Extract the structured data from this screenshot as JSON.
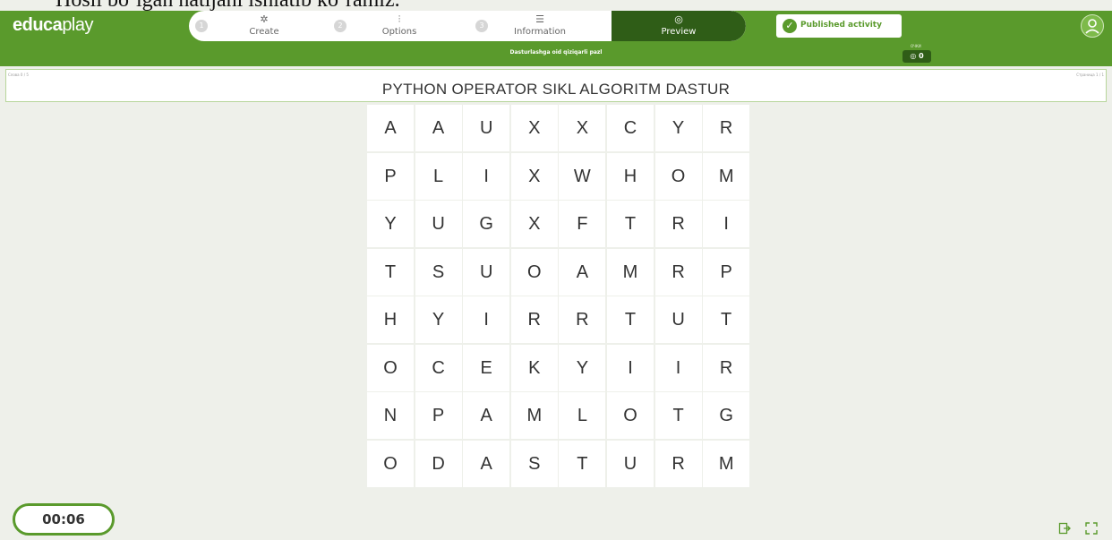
{
  "document_text": "Hosil bo‘lgan natijani ishlatib ko‘ramiz.",
  "header": {
    "logo_bold": "educa",
    "logo_light": "play",
    "steps": [
      {
        "num": "1",
        "label": "Create",
        "icon": "puzzle-icon"
      },
      {
        "num": "2",
        "label": "Options",
        "icon": "sliders-icon"
      },
      {
        "num": "3",
        "label": "Information",
        "icon": "list-icon"
      },
      {
        "label": "Preview",
        "icon": "eye-icon"
      }
    ],
    "published_label": "Published activity"
  },
  "activity": {
    "title": "Dasturlashga oid qiziqarli pazl",
    "score_label": "ОЧКИ",
    "score": "0",
    "words_found": "Слова 0 / 5",
    "page": "Страница 1 / 1",
    "words": "PYTHON OPERATOR SIKL ALGORITM DASTUR"
  },
  "grid": [
    [
      "A",
      "A",
      "U",
      "X",
      "X",
      "C",
      "Y",
      "R"
    ],
    [
      "P",
      "L",
      "I",
      "X",
      "W",
      "H",
      "O",
      "M"
    ],
    [
      "Y",
      "U",
      "G",
      "X",
      "F",
      "T",
      "R",
      "I"
    ],
    [
      "T",
      "S",
      "U",
      "O",
      "A",
      "M",
      "R",
      "P"
    ],
    [
      "H",
      "Y",
      "I",
      "R",
      "R",
      "T",
      "U",
      "T"
    ],
    [
      "O",
      "C",
      "E",
      "K",
      "Y",
      "I",
      "I",
      "R"
    ],
    [
      "N",
      "P",
      "A",
      "M",
      "L",
      "O",
      "T",
      "G"
    ],
    [
      "O",
      "D",
      "A",
      "S",
      "T",
      "U",
      "R",
      "M"
    ]
  ],
  "timer": "00:06",
  "colors": {
    "brand": "#5a9a2c",
    "brand_dark": "#2f5d17",
    "background": "#eef0ea"
  }
}
